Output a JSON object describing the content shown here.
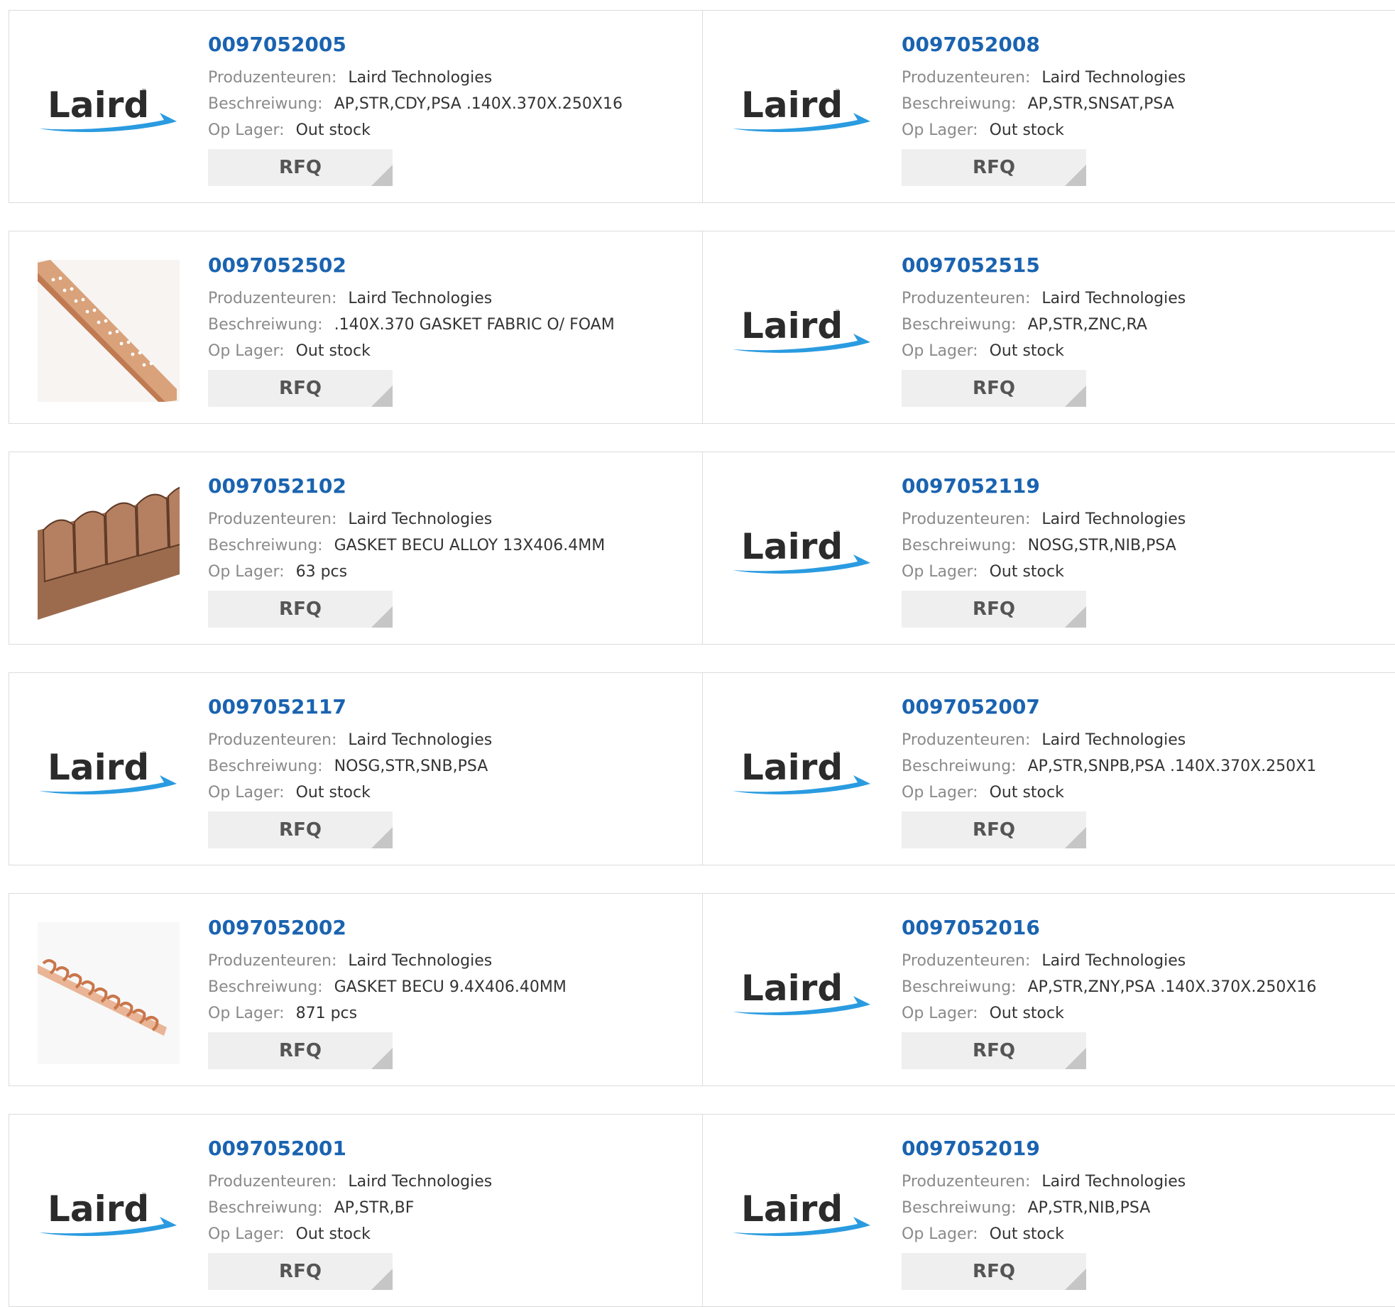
{
  "labels": {
    "manufacturer": "Produzenteuren:",
    "description": "Beschreiwung:",
    "stock": "Op Lager:",
    "rfq": "RFQ"
  },
  "brand": {
    "logo_text": "Laird",
    "text_color": "#2b2b2b",
    "swoosh_color": "#2a9be0"
  },
  "colors": {
    "part_link": "#1a63b0",
    "label": "#8a8a8a",
    "value": "#333333",
    "button_bg": "#efefef"
  },
  "products": [
    {
      "part": "0097052005",
      "manufacturer": "Laird Technologies",
      "description": "AP,STR,CDY,PSA .140X.370X.250X16",
      "stock": "Out stock",
      "image": "laird-logo"
    },
    {
      "part": "0097052008",
      "manufacturer": "Laird Technologies",
      "description": "AP,STR,SNSAT,PSA",
      "stock": "Out stock",
      "image": "laird-logo"
    },
    {
      "part": "0097052502",
      "manufacturer": "Laird Technologies",
      "description": ".140X.370 GASKET FABRIC O/ FOAM",
      "stock": "Out stock",
      "image": "gasket-strip-perforated"
    },
    {
      "part": "0097052515",
      "manufacturer": "Laird Technologies",
      "description": "AP,STR,ZNC,RA",
      "stock": "Out stock",
      "image": "laird-logo"
    },
    {
      "part": "0097052102",
      "manufacturer": "Laird Technologies",
      "description": "GASKET BECU ALLOY 13X406.4MM",
      "stock": "63 pcs",
      "image": "gasket-strip-fingers"
    },
    {
      "part": "0097052119",
      "manufacturer": "Laird Technologies",
      "description": "NOSG,STR,NIB,PSA",
      "stock": "Out stock",
      "image": "laird-logo"
    },
    {
      "part": "0097052117",
      "manufacturer": "Laird Technologies",
      "description": "NOSG,STR,SNB,PSA",
      "stock": "Out stock",
      "image": "laird-logo"
    },
    {
      "part": "0097052007",
      "manufacturer": "Laird Technologies",
      "description": "AP,STR,SNPB,PSA .140X.370X.250X1",
      "stock": "Out stock",
      "image": "laird-logo"
    },
    {
      "part": "0097052002",
      "manufacturer": "Laird Technologies",
      "description": "GASKET BECU 9.4X406.40MM",
      "stock": "871 pcs",
      "image": "gasket-strip-spiral"
    },
    {
      "part": "0097052016",
      "manufacturer": "Laird Technologies",
      "description": "AP,STR,ZNY,PSA .140X.370X.250X16",
      "stock": "Out stock",
      "image": "laird-logo"
    },
    {
      "part": "0097052001",
      "manufacturer": "Laird Technologies",
      "description": "AP,STR,BF",
      "stock": "Out stock",
      "image": "laird-logo"
    },
    {
      "part": "0097052019",
      "manufacturer": "Laird Technologies",
      "description": "AP,STR,NIB,PSA",
      "stock": "Out stock",
      "image": "laird-logo"
    }
  ]
}
